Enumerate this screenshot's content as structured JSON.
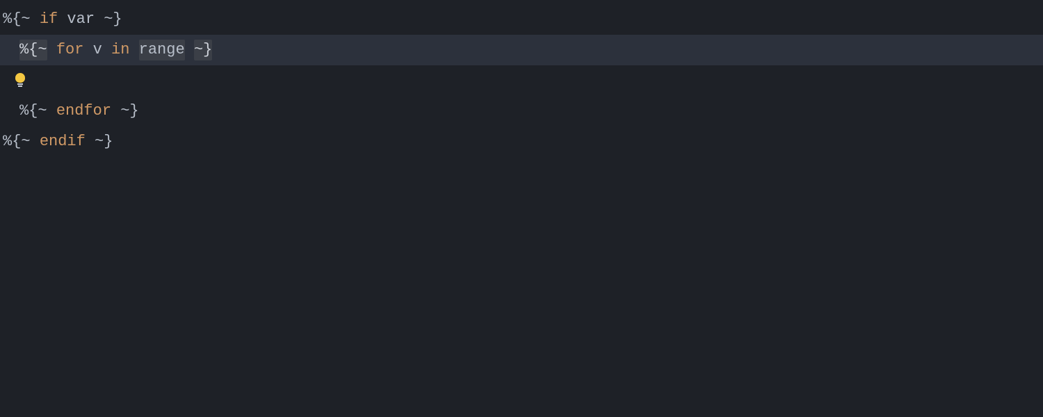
{
  "colors": {
    "background": "#1e2127",
    "highlight_line": "#2c313c",
    "delimiter_highlight": "#3b3f47",
    "keyword": "#d19a66",
    "text": "#abb2bf",
    "bulb": "#f5c842"
  },
  "lines": [
    {
      "indent": 0,
      "highlighted": false,
      "tokens": [
        {
          "text": "%{~",
          "kind": "delim"
        },
        {
          "text": " ",
          "kind": "space"
        },
        {
          "text": "if",
          "kind": "keyword"
        },
        {
          "text": " ",
          "kind": "space"
        },
        {
          "text": "var",
          "kind": "ident"
        },
        {
          "text": " ",
          "kind": "space"
        },
        {
          "text": "~}",
          "kind": "delim"
        }
      ]
    },
    {
      "indent": 1,
      "highlighted": true,
      "tokens": [
        {
          "text": "%{~",
          "kind": "delim-hl"
        },
        {
          "text": " ",
          "kind": "space"
        },
        {
          "text": "for",
          "kind": "keyword"
        },
        {
          "text": " ",
          "kind": "space"
        },
        {
          "text": "v",
          "kind": "ident"
        },
        {
          "text": " ",
          "kind": "space"
        },
        {
          "text": "in",
          "kind": "keyword"
        },
        {
          "text": " ",
          "kind": "space"
        },
        {
          "text": "range",
          "kind": "ident-hl"
        },
        {
          "text": " ",
          "kind": "space"
        },
        {
          "text": "~}",
          "kind": "delim-hl"
        }
      ]
    },
    {
      "indent": 1,
      "highlighted": false,
      "bulb": true,
      "tokens": []
    },
    {
      "indent": 1,
      "highlighted": false,
      "tokens": [
        {
          "text": "%{~",
          "kind": "delim"
        },
        {
          "text": " ",
          "kind": "space"
        },
        {
          "text": "endfor",
          "kind": "keyword"
        },
        {
          "text": " ",
          "kind": "space"
        },
        {
          "text": "~}",
          "kind": "delim"
        }
      ]
    },
    {
      "indent": 0,
      "highlighted": false,
      "tokens": [
        {
          "text": "%{~",
          "kind": "delim"
        },
        {
          "text": " ",
          "kind": "space"
        },
        {
          "text": "endif",
          "kind": "keyword"
        },
        {
          "text": " ",
          "kind": "space"
        },
        {
          "text": "~}",
          "kind": "delim"
        }
      ]
    }
  ],
  "icons": {
    "lightbulb": "lightbulb-icon"
  }
}
